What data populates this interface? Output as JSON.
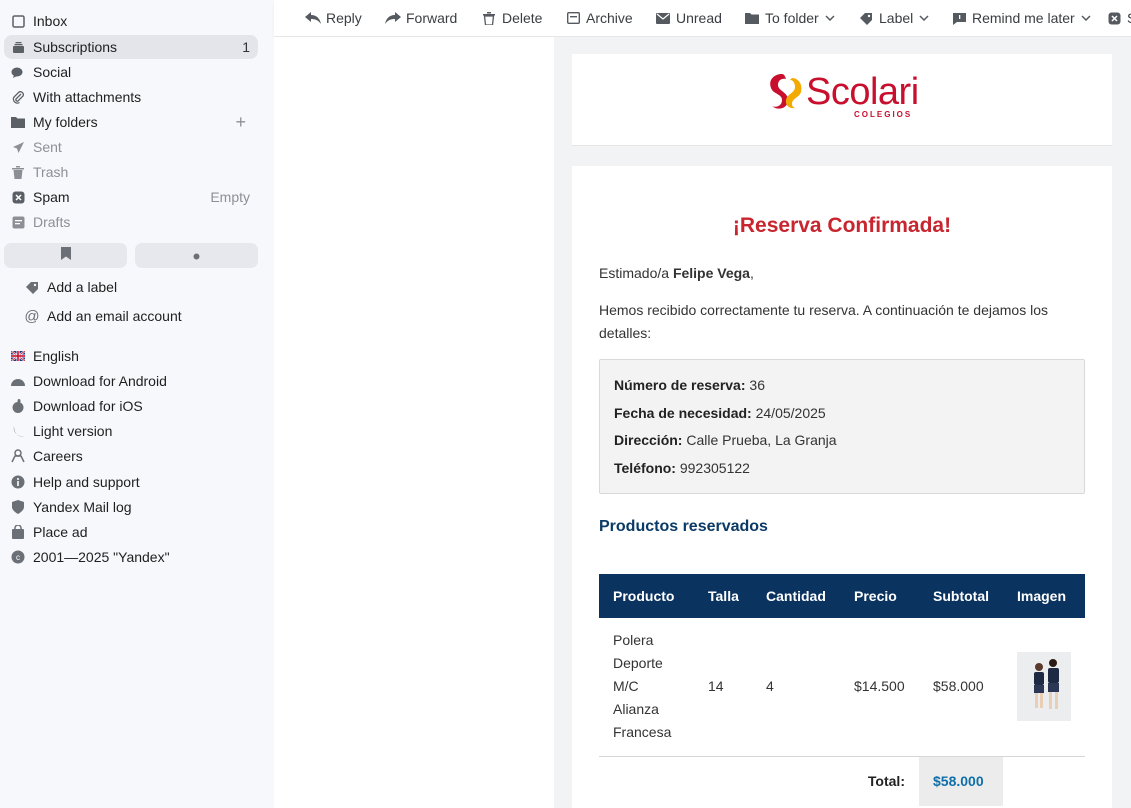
{
  "sidebar": {
    "folders": [
      {
        "label": "Inbox",
        "icon": "inbox-icon"
      },
      {
        "label": "Subscriptions",
        "icon": "subscriptions-icon",
        "count": "1"
      },
      {
        "label": "Social",
        "icon": "social-icon"
      },
      {
        "label": "With attachments",
        "icon": "paperclip-icon"
      },
      {
        "label": "My folders",
        "icon": "folder-icon"
      },
      {
        "label": "Sent",
        "icon": "send-icon"
      },
      {
        "label": "Trash",
        "icon": "trash-icon"
      },
      {
        "label": "Spam",
        "icon": "spam-icon",
        "count": "Empty"
      },
      {
        "label": "Drafts",
        "icon": "drafts-icon"
      }
    ],
    "add_label": "Add a label",
    "add_account": "Add an email account",
    "footer": [
      {
        "label": "English",
        "icon": "uk-flag-icon"
      },
      {
        "label": "Download for Android",
        "icon": "android-icon"
      },
      {
        "label": "Download for iOS",
        "icon": "apple-icon"
      },
      {
        "label": "Light version",
        "icon": "light-version-icon"
      },
      {
        "label": "Careers",
        "icon": "careers-icon"
      },
      {
        "label": "Help and support",
        "icon": "info-icon"
      },
      {
        "label": "Yandex Mail log",
        "icon": "shield-icon"
      },
      {
        "label": "Place ad",
        "icon": "bag-icon"
      },
      {
        "label": "2001—2025 \"Yandex\"",
        "icon": "copyright-icon"
      }
    ]
  },
  "toolbar": {
    "reply": "Reply",
    "forward": "Forward",
    "delete": "Delete",
    "archive": "Archive",
    "unread": "Unread",
    "to_folder": "To folder",
    "label": "Label",
    "remind": "Remind me later",
    "overflow": "S"
  },
  "email": {
    "logo_text": "Scolari",
    "logo_sub": "COLEGIOS",
    "title": "¡Reserva Confirmada!",
    "greeting_prefix": "Estimado/a ",
    "customer_name": "Felipe Vega",
    "greeting_suffix": ",",
    "intro": "Hemos recibido correctamente tu reserva. A continuación te dejamos los detalles:",
    "details": [
      {
        "label": "Número de reserva:",
        "value": " 36"
      },
      {
        "label": "Fecha de necesidad:",
        "value": " 24/05/2025"
      },
      {
        "label": "Dirección:",
        "value": " Calle Prueba, La Granja"
      },
      {
        "label": "Teléfono:",
        "value": " 992305122"
      }
    ],
    "products_title": "Productos reservados",
    "table_headers": [
      "Producto",
      "Talla",
      "Cantidad",
      "Precio",
      "Subtotal",
      "Imagen"
    ],
    "rows": [
      {
        "producto": "Polera Deporte M/C Alianza Francesa",
        "talla": "14",
        "cantidad": "4",
        "precio": "$14.500",
        "subtotal": "$58.000"
      }
    ],
    "total_label": "Total:",
    "total_value": "$58.000"
  },
  "colors": {
    "brand_red": "#c8262f",
    "header_navy": "#0b3360",
    "total_blue": "#0f6fa8"
  }
}
